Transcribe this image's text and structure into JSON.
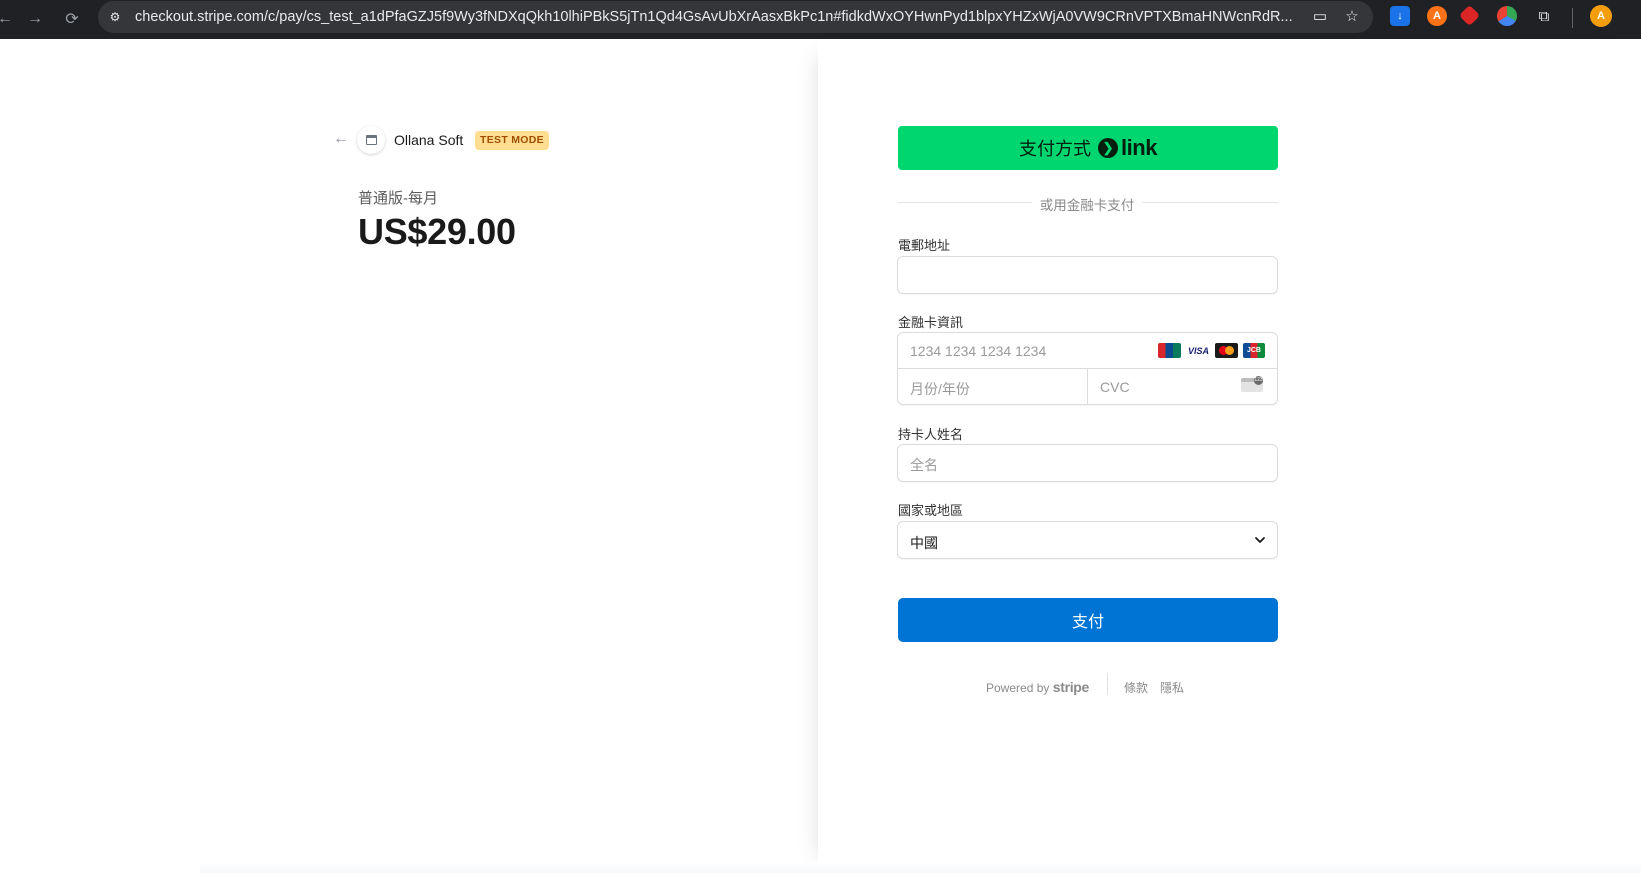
{
  "browser": {
    "url": "checkout.stripe.com/c/pay/cs_test_a1dPfaGZJ5f9Wy3fNDXqQkh10lhiPBkS5jTn1Qd4GsAvUbXrAasxBkPc1n#fidkdWxOYHwnPyd1blpxYHZxWjA0VW9CRnVPTXBmaHNWcnRdR...",
    "back_icon": "←",
    "forward_icon": "→",
    "reload_icon": "⟳",
    "site_info_icon": "⚙",
    "card_icon": "▭",
    "star_icon": "☆",
    "extensions_icon": "⧉"
  },
  "merchant": {
    "back_icon": "←",
    "name": "Ollana Soft",
    "test_badge": "TEST MODE"
  },
  "product": {
    "name": "普通版-每月",
    "price": "US$29.00"
  },
  "form": {
    "link_button_label": "支付方式",
    "link_chevron": "❯",
    "link_word": "link",
    "divider_text": "或用金融卡支付",
    "email_label": "電郵地址",
    "card_label": "金融卡資訊",
    "card_number_placeholder": "1234 1234 1234 1234",
    "expiry_placeholder": "月份/年份",
    "cvc_placeholder": "CVC",
    "card_brands": [
      "UnionPay",
      "VISA",
      "",
      "JCB"
    ],
    "name_label": "持卡人姓名",
    "name_placeholder": "全名",
    "country_label": "國家或地區",
    "country_value": "中國",
    "chevron_icon": "⌄",
    "pay_button": "支付"
  },
  "footer": {
    "powered_by": "Powered by",
    "stripe": "stripe",
    "terms": "條款",
    "privacy": "隱私"
  }
}
